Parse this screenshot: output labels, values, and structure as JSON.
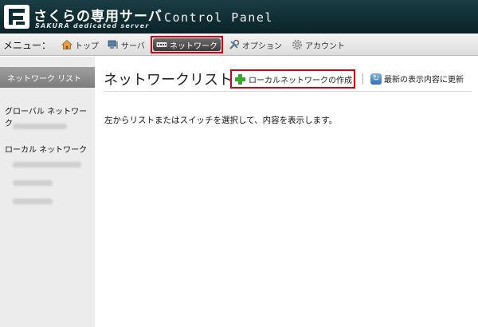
{
  "header": {
    "logo_text": "さくらの専用サーバ",
    "logo_sub": "SAKURA dedicated server",
    "title": "Control Panel"
  },
  "menubar": {
    "label": "メニュー：",
    "items": [
      {
        "label": "トップ",
        "icon": "home-icon"
      },
      {
        "label": "サーバ",
        "icon": "server-icon"
      },
      {
        "label": "ネットワーク",
        "icon": "network-switch-icon",
        "active": true
      },
      {
        "label": "オプション",
        "icon": "tools-icon"
      },
      {
        "label": "アカウント",
        "icon": "gear-icon"
      }
    ]
  },
  "sidebar": {
    "header": "ネットワーク リスト",
    "groups": [
      {
        "label": "グローバル ネットワーク"
      },
      {
        "label": "ローカル ネットワーク"
      }
    ]
  },
  "main": {
    "title": "ネットワークリスト",
    "create_label": "ローカルネットワークの作成",
    "refresh_label": "最新の表示内容に更新",
    "message": "左からリストまたはスイッチを選択して、内容を表示します。"
  },
  "colors": {
    "header_bg": "#0f2d33",
    "highlight": "#d9000d",
    "plus_green": "#38a82c",
    "sidebar_bg": "#ececec"
  }
}
